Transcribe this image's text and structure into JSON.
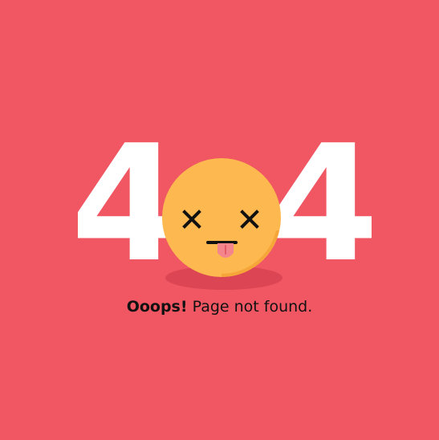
{
  "error_code": {
    "left_digit": "4",
    "right_digit": "4"
  },
  "message": {
    "exclamation": "Ooops!",
    "text": "Page not found."
  },
  "colors": {
    "background": "#F05763",
    "digits": "#FFFFFF",
    "face": "#FDB94F",
    "face_shade": "#F6A538",
    "eyes": "#111111",
    "tongue": "#F5858C"
  },
  "icons": {
    "face": "dizzy-face-icon"
  }
}
